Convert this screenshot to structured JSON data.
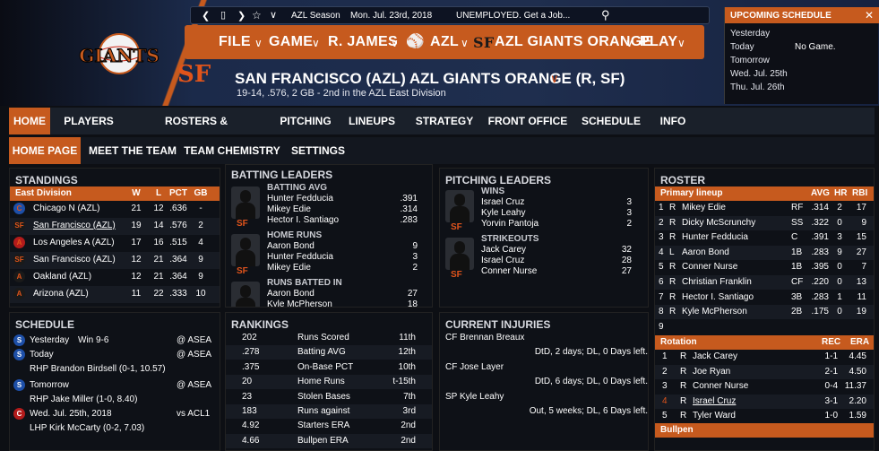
{
  "topbar": {
    "context": "AZL Season",
    "date": "Mon. Jul. 23rd, 2018",
    "status": "UNEMPLOYED. Get a Job..."
  },
  "nav": {
    "file": "FILE",
    "game": "GAME",
    "manager": "R. JAMES",
    "league": "AZL",
    "team": "AZL GIANTS ORANGE",
    "play": "PLAY"
  },
  "logo_text": "GIANTS",
  "team": {
    "title": "SAN FRANCISCO (AZL) AZL GIANTS ORANGE (R, SF)",
    "record": "19-14, .576, 2 GB - 2nd in the AZL East Division"
  },
  "upcoming": {
    "title": "UPCOMING SCHEDULE",
    "rows": [
      {
        "day": "Yesterday",
        "note": ""
      },
      {
        "day": "Today",
        "note": "No Game."
      },
      {
        "day": "Tomorrow",
        "note": ""
      },
      {
        "day": "Wed. Jul. 25th",
        "note": ""
      },
      {
        "day": "Thu. Jul. 26th",
        "note": ""
      }
    ]
  },
  "tabs": [
    "HOME",
    "PLAYERS",
    "ROSTERS & TRANSACTIONS",
    "PITCHING",
    "LINEUPS",
    "STRATEGY",
    "FRONT OFFICE",
    "SCHEDULE",
    "INFO"
  ],
  "subtabs": [
    "HOME PAGE",
    "MEET THE TEAM",
    "TEAM CHEMISTRY",
    "SETTINGS"
  ],
  "standings": {
    "title": "STANDINGS",
    "division": "East Division",
    "cols": [
      "W",
      "L",
      "PCT",
      "GB"
    ],
    "rows": [
      [
        "Chicago N (AZL)",
        "21",
        "12",
        ".636",
        "-"
      ],
      [
        "San Francisco (AZL)",
        "19",
        "14",
        ".576",
        "2"
      ],
      [
        "Los Angeles A (AZL)",
        "17",
        "16",
        ".515",
        "4"
      ],
      [
        "San Francisco (AZL)",
        "12",
        "21",
        ".364",
        "9"
      ],
      [
        "Oakland (AZL)",
        "12",
        "21",
        ".364",
        "9"
      ],
      [
        "Arizona (AZL)",
        "11",
        "22",
        ".333",
        "10"
      ]
    ]
  },
  "batting": {
    "title": "BATTING LEADERS",
    "groups": [
      {
        "label": "BATTING AVG",
        "rows": [
          [
            "Hunter Fedducia",
            ".391"
          ],
          [
            "Mikey Edie",
            ".314"
          ],
          [
            "Hector I. Santiago",
            ".283"
          ]
        ]
      },
      {
        "label": "HOME RUNS",
        "rows": [
          [
            "Aaron Bond",
            "9"
          ],
          [
            "Hunter Fedducia",
            "3"
          ],
          [
            "Mikey Edie",
            "2"
          ]
        ]
      },
      {
        "label": "RUNS BATTED IN",
        "rows": [
          [
            "Aaron Bond",
            "27"
          ],
          [
            "Kyle McPherson",
            "18"
          ]
        ]
      }
    ]
  },
  "pitching": {
    "title": "PITCHING LEADERS",
    "groups": [
      {
        "label": "WINS",
        "rows": [
          [
            "Israel Cruz",
            "3"
          ],
          [
            "Kyle Leahy",
            "3"
          ],
          [
            "Yorvin Pantoja",
            "2"
          ]
        ]
      },
      {
        "label": "STRIKEOUTS",
        "rows": [
          [
            "Jack Carey",
            "32"
          ],
          [
            "Israel Cruz",
            "28"
          ],
          [
            "Conner Nurse",
            "27"
          ]
        ]
      }
    ]
  },
  "roster": {
    "title": "ROSTER",
    "lineup_label": "Primary lineup",
    "cols": [
      "AVG",
      "HR",
      "RBI"
    ],
    "lineup": [
      [
        "1",
        "R",
        "Mikey Edie",
        "RF",
        ".314",
        "2",
        "17"
      ],
      [
        "2",
        "R",
        "Dicky McScrunchy",
        "SS",
        ".322",
        "0",
        "9"
      ],
      [
        "3",
        "R",
        "Hunter Fedducia",
        "C",
        ".391",
        "3",
        "15"
      ],
      [
        "4",
        "L",
        "Aaron Bond",
        "1B",
        ".283",
        "9",
        "27"
      ],
      [
        "5",
        "R",
        "Conner Nurse",
        "1B",
        ".395",
        "0",
        "7"
      ],
      [
        "6",
        "R",
        "Christian Franklin",
        "CF",
        ".220",
        "0",
        "13"
      ],
      [
        "7",
        "R",
        "Hector I. Santiago",
        "3B",
        ".283",
        "1",
        "11"
      ],
      [
        "8",
        "R",
        "Kyle McPherson",
        "2B",
        ".175",
        "0",
        "19"
      ],
      [
        "9",
        "",
        "",
        "",
        "",
        "",
        ""
      ]
    ],
    "rotation_label": "Rotation",
    "rot_cols": [
      "REC",
      "ERA"
    ],
    "rotation": [
      [
        "1",
        "R",
        "Jack Carey",
        "1-1",
        "4.45"
      ],
      [
        "2",
        "R",
        "Joe Ryan",
        "2-1",
        "4.50"
      ],
      [
        "3",
        "R",
        "Conner Nurse",
        "0-4",
        "11.37"
      ],
      [
        "4",
        "R",
        "Israel Cruz",
        "3-1",
        "2.20"
      ],
      [
        "5",
        "R",
        "Tyler Ward",
        "1-0",
        "1.59"
      ]
    ],
    "bullpen_label": "Bullpen"
  },
  "schedule": {
    "title": "SCHEDULE",
    "rows": [
      {
        "day": "Yesterday",
        "result": "Win 9-6",
        "opp": "@ ASEA",
        "pitcher": ""
      },
      {
        "day": "Today",
        "result": "",
        "opp": "@ ASEA",
        "pitcher": "RHP Brandon Birdsell (0-1, 10.57)"
      },
      {
        "day": "Tomorrow",
        "result": "",
        "opp": "@ ASEA",
        "pitcher": "RHP Jake Miller (1-0, 8.40)"
      },
      {
        "day": "Wed. Jul. 25th, 2018",
        "result": "",
        "opp": "vs ACL1",
        "pitcher": "LHP Kirk McCarty (0-2, 7.03)"
      }
    ]
  },
  "rankings": {
    "title": "RANKINGS",
    "rows": [
      [
        "202",
        "Runs Scored",
        "11th"
      ],
      [
        ".278",
        "Batting AVG",
        "12th"
      ],
      [
        ".375",
        "On-Base PCT",
        "10th"
      ],
      [
        "20",
        "Home Runs",
        "t-15th"
      ],
      [
        "23",
        "Stolen Bases",
        "7th"
      ],
      [
        "183",
        "Runs against",
        "3rd"
      ],
      [
        "4.92",
        "Starters ERA",
        "2nd"
      ],
      [
        "4.66",
        "Bullpen ERA",
        "2nd"
      ]
    ]
  },
  "injuries": {
    "title": "CURRENT INJURIES",
    "rows": [
      [
        "CF Brennan Breaux",
        "DtD, 2 days; DL, 0 Days left."
      ],
      [
        "CF Jose Layer",
        "DtD, 6 days; DL, 0 Days left."
      ],
      [
        "SP Kyle Leahy",
        "Out, 5 weeks; DL, 6 Days left."
      ]
    ]
  }
}
